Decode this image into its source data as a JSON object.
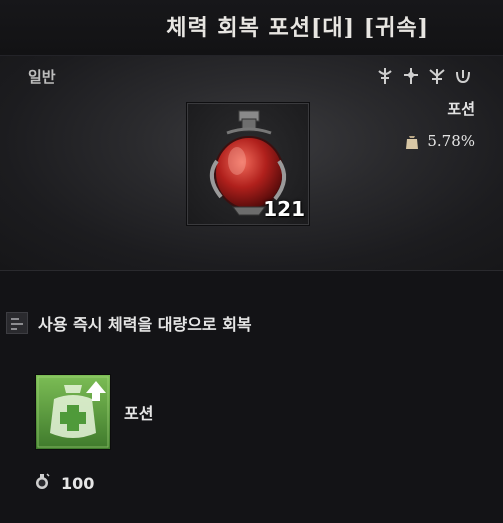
{
  "item": {
    "title": "체력 회복 포션[대] [귀속]",
    "grade": "일반",
    "category": "포션",
    "weight": "5.78%",
    "quantity": "121",
    "class_icons": [
      "class-icon-1",
      "class-icon-2",
      "class-icon-3",
      "class-icon-4"
    ]
  },
  "description": {
    "text": "사용 즉시 체력을 대량으로 회복"
  },
  "effect": {
    "label": "포션",
    "icon": "health-potion-buff-icon"
  },
  "stat": {
    "icon": "potion-stat-icon",
    "value": "100"
  },
  "colors": {
    "potion_red": "#b0201c",
    "buff_green": "#6aa845",
    "background": "#131316"
  }
}
